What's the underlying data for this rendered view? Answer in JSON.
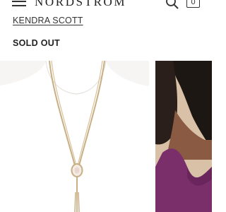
{
  "header": {
    "logo_text": "NORDSTROM",
    "bag_count": "0",
    "icons": {
      "menu": "hamburger-menu-icon",
      "search": "search-icon",
      "bag": "shopping-bag-icon"
    }
  },
  "product": {
    "brand": "KENDRA SCOTT",
    "status": "SOLD OUT"
  },
  "colors": {
    "text": "#222222",
    "image_background": "#f6f5f3",
    "necklace_gold": "#c9ae84",
    "model_dress": "#7a2f6b"
  }
}
